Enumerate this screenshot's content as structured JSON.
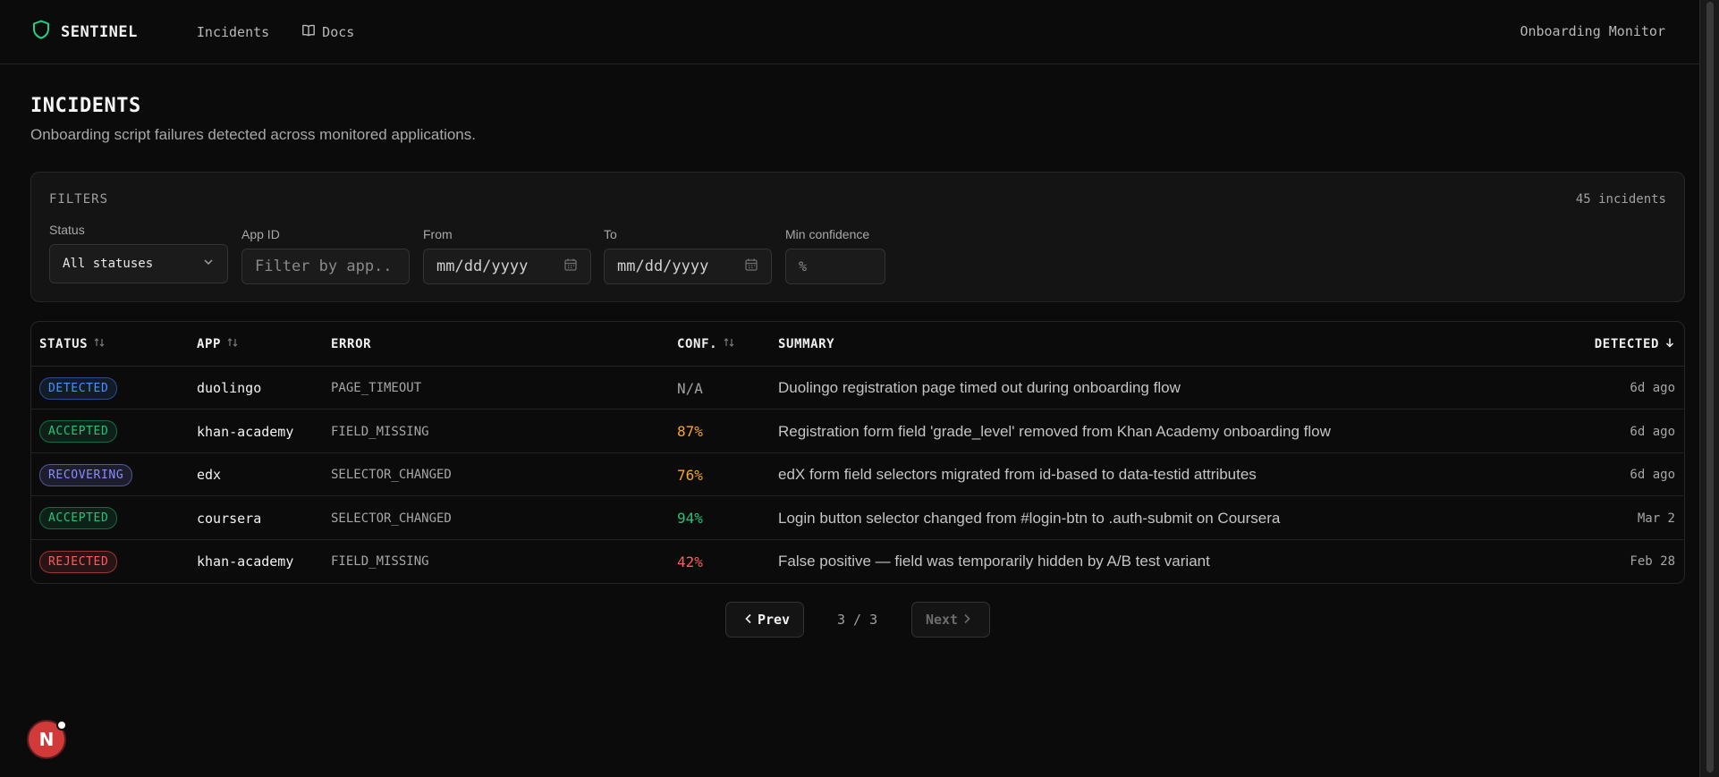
{
  "colors": {
    "accent_green": "#1fd18b",
    "detected": "#4a90ff",
    "accepted": "#27c27a",
    "recovering": "#8b8cff",
    "rejected": "#ff5c5c",
    "conf_amber": "#f5a623",
    "conf_green": "#27c27a",
    "conf_red": "#ff5c5c"
  },
  "header": {
    "brand": "SENTINEL",
    "brand_icon": "shield-icon",
    "nav": [
      {
        "label": "Incidents"
      },
      {
        "label": "Docs",
        "icon": "book-icon"
      }
    ],
    "right_label": "Onboarding Monitor"
  },
  "page": {
    "title": "INCIDENTS",
    "subtitle": "Onboarding script failures detected across monitored applications."
  },
  "filters": {
    "title": "FILTERS",
    "count": "45 incidents",
    "status": {
      "label": "Status",
      "value": "All statuses"
    },
    "app_id": {
      "label": "App ID",
      "placeholder": "Filter by app.."
    },
    "from": {
      "label": "From",
      "placeholder": "mm/dd/yyyy"
    },
    "to": {
      "label": "To",
      "placeholder": "mm/dd/yyyy"
    },
    "min_confidence": {
      "label": "Min confidence",
      "placeholder": "%"
    }
  },
  "table": {
    "columns": {
      "status": "STATUS",
      "app": "APP",
      "error": "ERROR",
      "conf": "CONF.",
      "summary": "SUMMARY",
      "detected": "DETECTED"
    },
    "rows": [
      {
        "status": "DETECTED",
        "app": "duolingo",
        "error": "PAGE_TIMEOUT",
        "conf": "N/A",
        "summary": "Duolingo registration page timed out during onboarding flow",
        "detected": "6d ago"
      },
      {
        "status": "ACCEPTED",
        "app": "khan-academy",
        "error": "FIELD_MISSING",
        "conf": "87%",
        "summary": "Registration form field 'grade_level' removed from Khan Academy onboarding flow",
        "detected": "6d ago"
      },
      {
        "status": "RECOVERING",
        "app": "edx",
        "error": "SELECTOR_CHANGED",
        "conf": "76%",
        "summary": "edX form field selectors migrated from id-based to data-testid attributes",
        "detected": "6d ago"
      },
      {
        "status": "ACCEPTED",
        "app": "coursera",
        "error": "SELECTOR_CHANGED",
        "conf": "94%",
        "summary": "Login button selector changed from #login-btn to .auth-submit on Coursera",
        "detected": "Mar 2"
      },
      {
        "status": "REJECTED",
        "app": "khan-academy",
        "error": "FIELD_MISSING",
        "conf": "42%",
        "summary": "False positive — field was temporarily hidden by A/B test variant",
        "detected": "Feb 28"
      }
    ]
  },
  "pagination": {
    "prev": "Prev",
    "info": "3 / 3",
    "next": "Next"
  },
  "floating_badge": "N"
}
